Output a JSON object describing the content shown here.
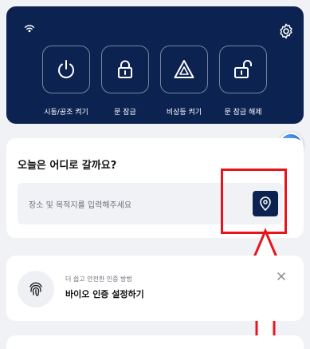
{
  "remote_controls": [
    {
      "label": "시동/공조 켜기",
      "icon": "power-icon"
    },
    {
      "label": "문 잠금",
      "icon": "lock-icon"
    },
    {
      "label": "비상등 켜기",
      "icon": "hazard-icon"
    },
    {
      "label": "문 잠금 해제",
      "icon": "unlock-icon"
    }
  ],
  "destination": {
    "title": "오늘은 어디로 갈까요?",
    "placeholder": "장소 및 목적지를 입력해주세요"
  },
  "bio": {
    "subtitle": "더 쉽고 안전한 인증 방법",
    "title": "바이오 인증 설정하기"
  },
  "colors": {
    "navy": "#0c2250",
    "highlight_red": "#e8141c",
    "background": "#f1f2f5"
  }
}
